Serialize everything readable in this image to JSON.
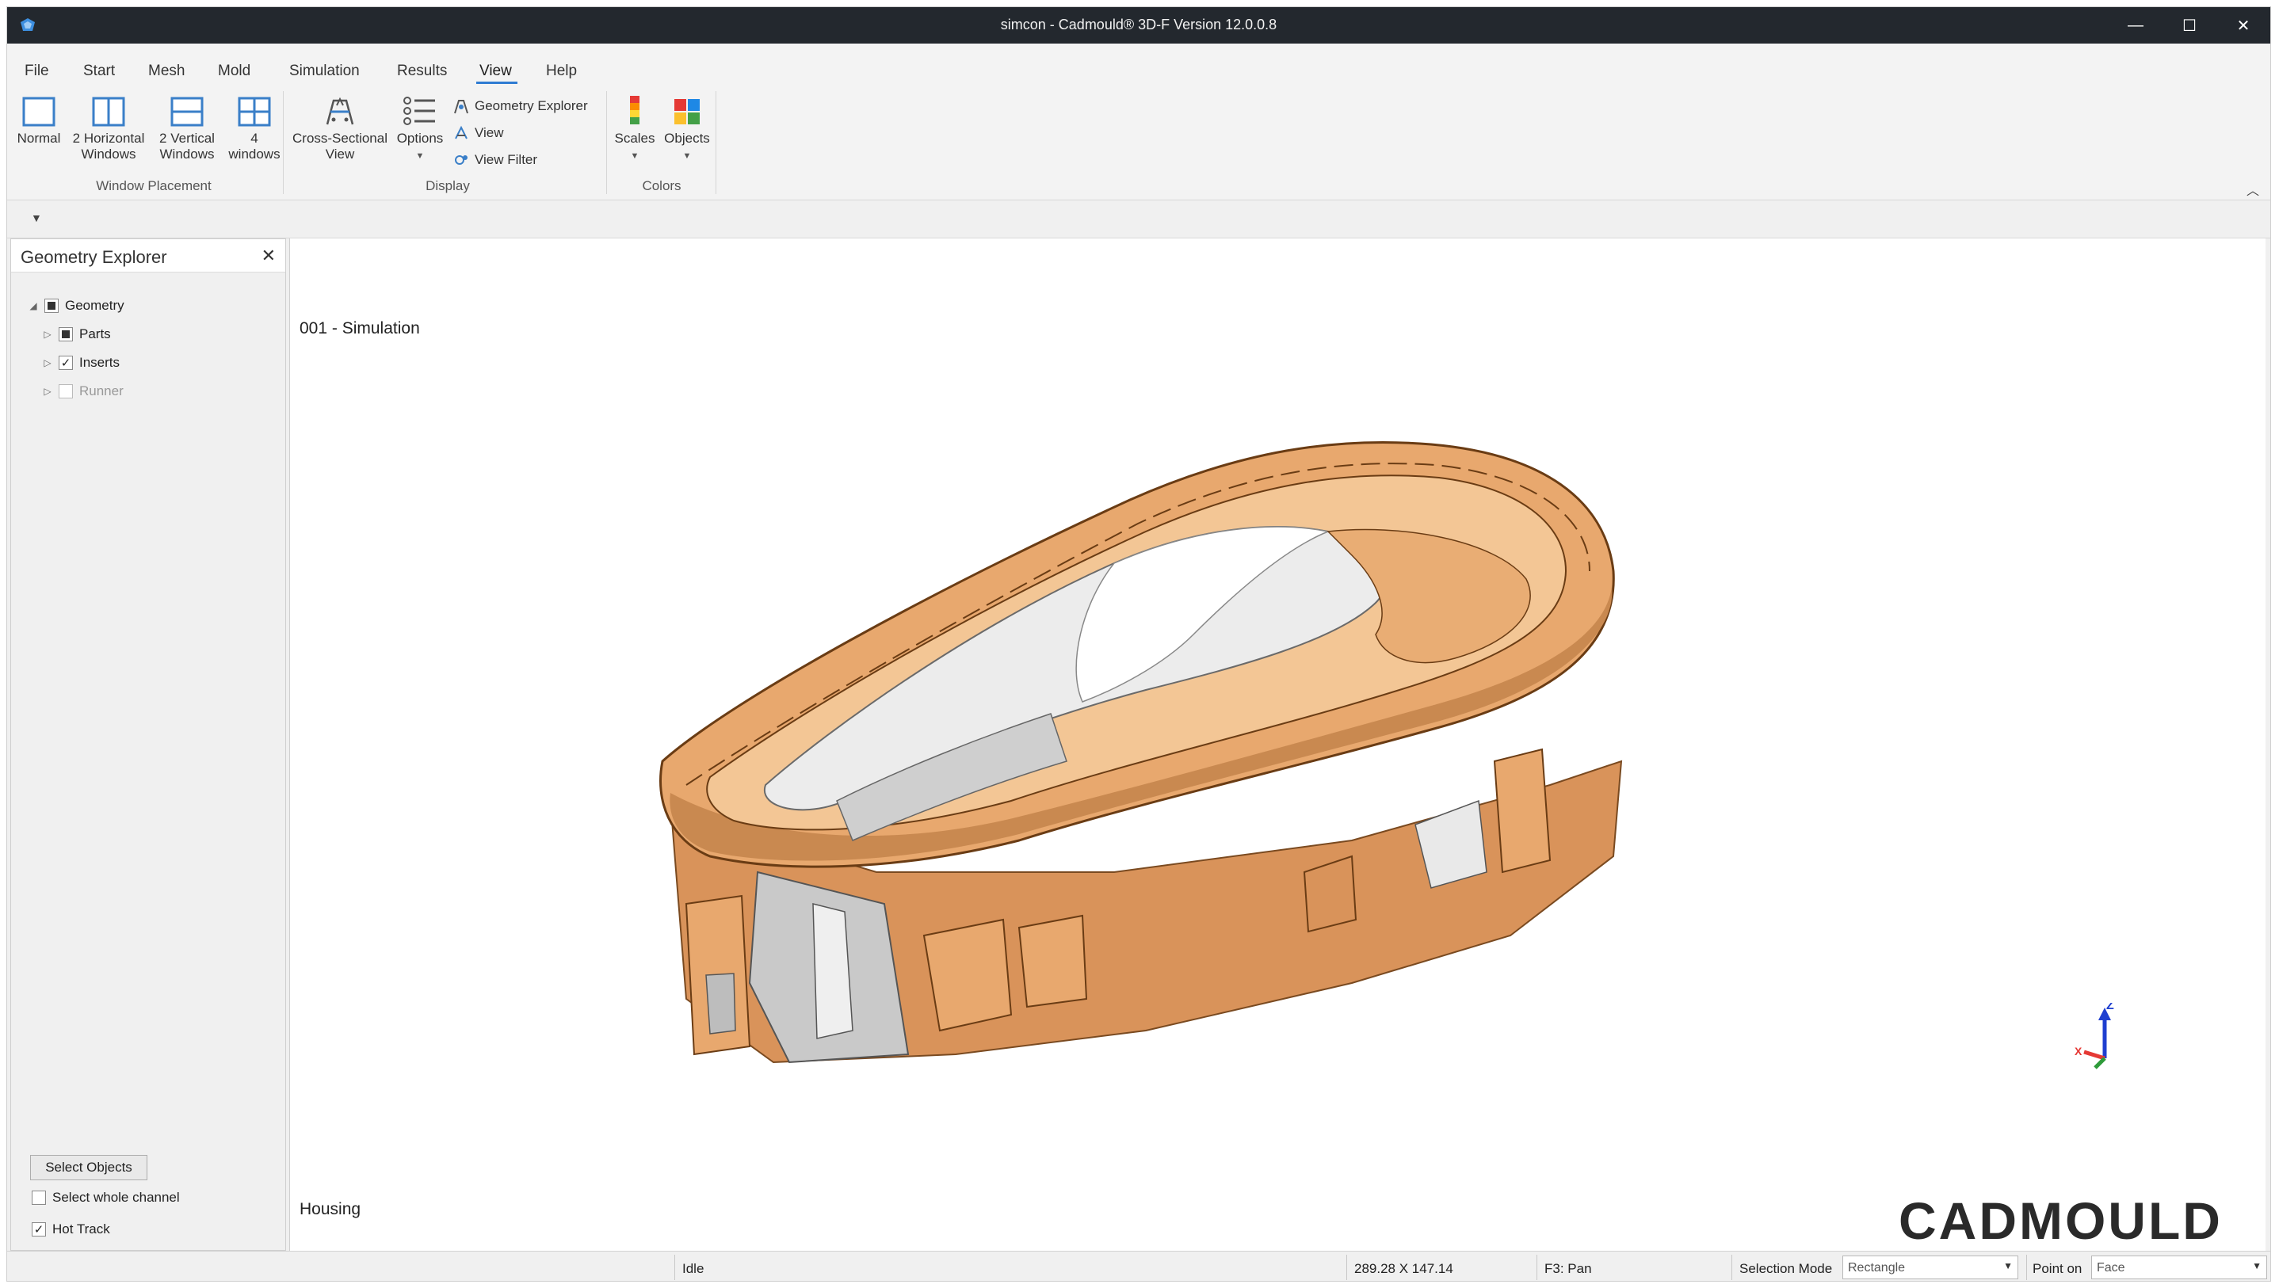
{
  "window": {
    "title": "simcon - Cadmould® 3D-F Version 12.0.0.8",
    "minimize": "—",
    "maximize": "☐",
    "close": "✕"
  },
  "menu": [
    "File",
    "Start",
    "Mesh",
    "Mold",
    "Simulation",
    "Results",
    "View",
    "Help"
  ],
  "menu_active": "View",
  "ribbon": {
    "window_placement": {
      "normal": "Normal",
      "two_horizontal": "2 Horizontal\nWindows",
      "two_vertical": "2 Vertical\nWindows",
      "four_windows": "4\nwindows",
      "group_label": "Window Placement"
    },
    "display": {
      "cross_sectional": "Cross-Sectional\nView",
      "options": "Options",
      "geometry_explorer": "Geometry Explorer",
      "view": "View",
      "view_filter": "View Filter",
      "group_label": "Display"
    },
    "colors": {
      "scales": "Scales",
      "objects": "Objects",
      "group_label": "Colors"
    },
    "collapse_icon": "chevron-up-icon"
  },
  "quick_access": {
    "dropdown_icon": "chevron-down-icon",
    "glyph": "▼"
  },
  "geometry_explorer": {
    "title": "Geometry Explorer",
    "close": "✕",
    "tree": {
      "root": "Geometry",
      "children": [
        "Parts",
        "Inserts",
        "Runner"
      ]
    },
    "tree_state": {
      "geometry": "partial",
      "parts": "partial",
      "inserts": "checked",
      "runner": "unchecked-disabled"
    },
    "select_objects": "Select Objects",
    "select_whole_channel": "Select whole channel",
    "select_whole_channel_checked": false,
    "hot_track": "Hot Track",
    "hot_track_checked": true
  },
  "viewport": {
    "simulation_label": "001 - Simulation",
    "part_label": "Housing",
    "logo": "CADMOULD",
    "axes": {
      "z": "Z",
      "x": "X"
    },
    "colors": {
      "part": "#e8a86e",
      "part_shade": "#c98950",
      "insert": "#e9e9e9",
      "insert_shade": "#b8b8b8"
    }
  },
  "status": {
    "state": "Idle",
    "dimensions": "289.28 X 147.14",
    "hint": "F3: Pan",
    "selection_mode_label": "Selection Mode",
    "selection_mode_value": "Rectangle",
    "point_on_label": "Point on",
    "point_on_value": "Face"
  }
}
